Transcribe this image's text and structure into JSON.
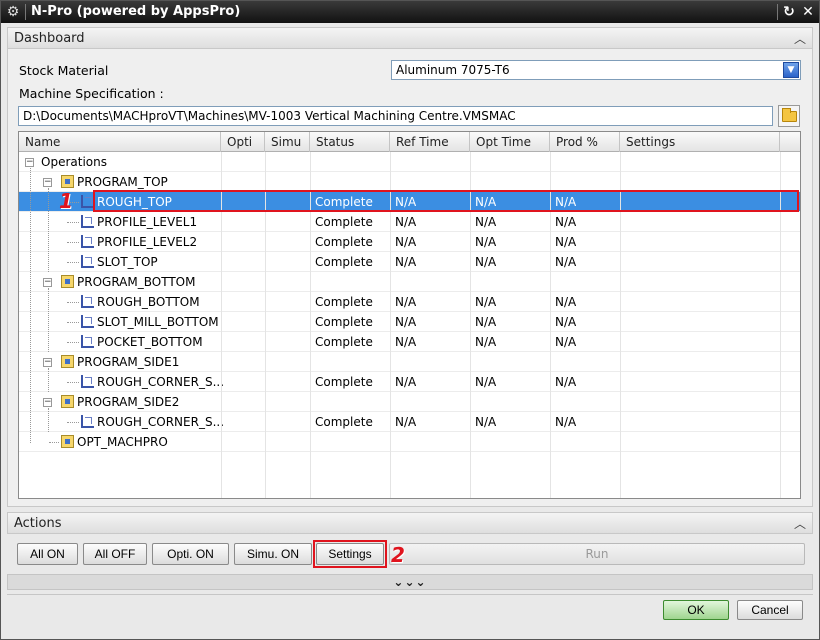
{
  "window": {
    "title": "N-Pro (powered by AppsPro)"
  },
  "dashboard": {
    "header": "Dashboard",
    "stock_label": "Stock Material",
    "stock_value": "Aluminum 7075-T6",
    "machine_label": "Machine Specification :",
    "machine_path": "D:\\Documents\\MACHproVT\\Machines\\MV-1003 Vertical Machining Centre.VMSMAC"
  },
  "table": {
    "columns": [
      "Name",
      "Opti",
      "Simu",
      "Status",
      "Ref Time",
      "Opt Time",
      "Prod %",
      "Settings"
    ],
    "rows": [
      {
        "name": "Operations",
        "status": "",
        "ref": "",
        "opt": "",
        "prod": ""
      },
      {
        "name": "PROGRAM_TOP",
        "status": "",
        "ref": "",
        "opt": "",
        "prod": ""
      },
      {
        "name": "ROUGH_TOP",
        "status": "Complete",
        "ref": "N/A",
        "opt": "N/A",
        "prod": "N/A"
      },
      {
        "name": "PROFILE_LEVEL1",
        "status": "Complete",
        "ref": "N/A",
        "opt": "N/A",
        "prod": "N/A"
      },
      {
        "name": "PROFILE_LEVEL2",
        "status": "Complete",
        "ref": "N/A",
        "opt": "N/A",
        "prod": "N/A"
      },
      {
        "name": "SLOT_TOP",
        "status": "Complete",
        "ref": "N/A",
        "opt": "N/A",
        "prod": "N/A"
      },
      {
        "name": "PROGRAM_BOTTOM",
        "status": "",
        "ref": "",
        "opt": "",
        "prod": ""
      },
      {
        "name": "ROUGH_BOTTOM",
        "status": "Complete",
        "ref": "N/A",
        "opt": "N/A",
        "prod": "N/A"
      },
      {
        "name": "SLOT_MILL_BOTTOM",
        "status": "Complete",
        "ref": "N/A",
        "opt": "N/A",
        "prod": "N/A"
      },
      {
        "name": "POCKET_BOTTOM",
        "status": "Complete",
        "ref": "N/A",
        "opt": "N/A",
        "prod": "N/A"
      },
      {
        "name": "PROGRAM_SIDE1",
        "status": "",
        "ref": "",
        "opt": "",
        "prod": ""
      },
      {
        "name": "ROUGH_CORNER_S...",
        "status": "Complete",
        "ref": "N/A",
        "opt": "N/A",
        "prod": "N/A"
      },
      {
        "name": "PROGRAM_SIDE2",
        "status": "",
        "ref": "",
        "opt": "",
        "prod": ""
      },
      {
        "name": "ROUGH_CORNER_S...",
        "status": "Complete",
        "ref": "N/A",
        "opt": "N/A",
        "prod": "N/A"
      },
      {
        "name": "OPT_MACHPRO",
        "status": "",
        "ref": "",
        "opt": "",
        "prod": ""
      }
    ]
  },
  "actions": {
    "header": "Actions",
    "all_on": "All ON",
    "all_off": "All OFF",
    "opti_on": "Opti. ON",
    "simu_on": "Simu. ON",
    "settings": "Settings",
    "run": "Run"
  },
  "callouts": {
    "one": "1",
    "two": "2"
  },
  "footer": {
    "ok": "OK",
    "cancel": "Cancel"
  },
  "colors": {
    "selection": "#3b8ee2",
    "callout": "#e0141e",
    "ok_green": "#9fd58f"
  }
}
